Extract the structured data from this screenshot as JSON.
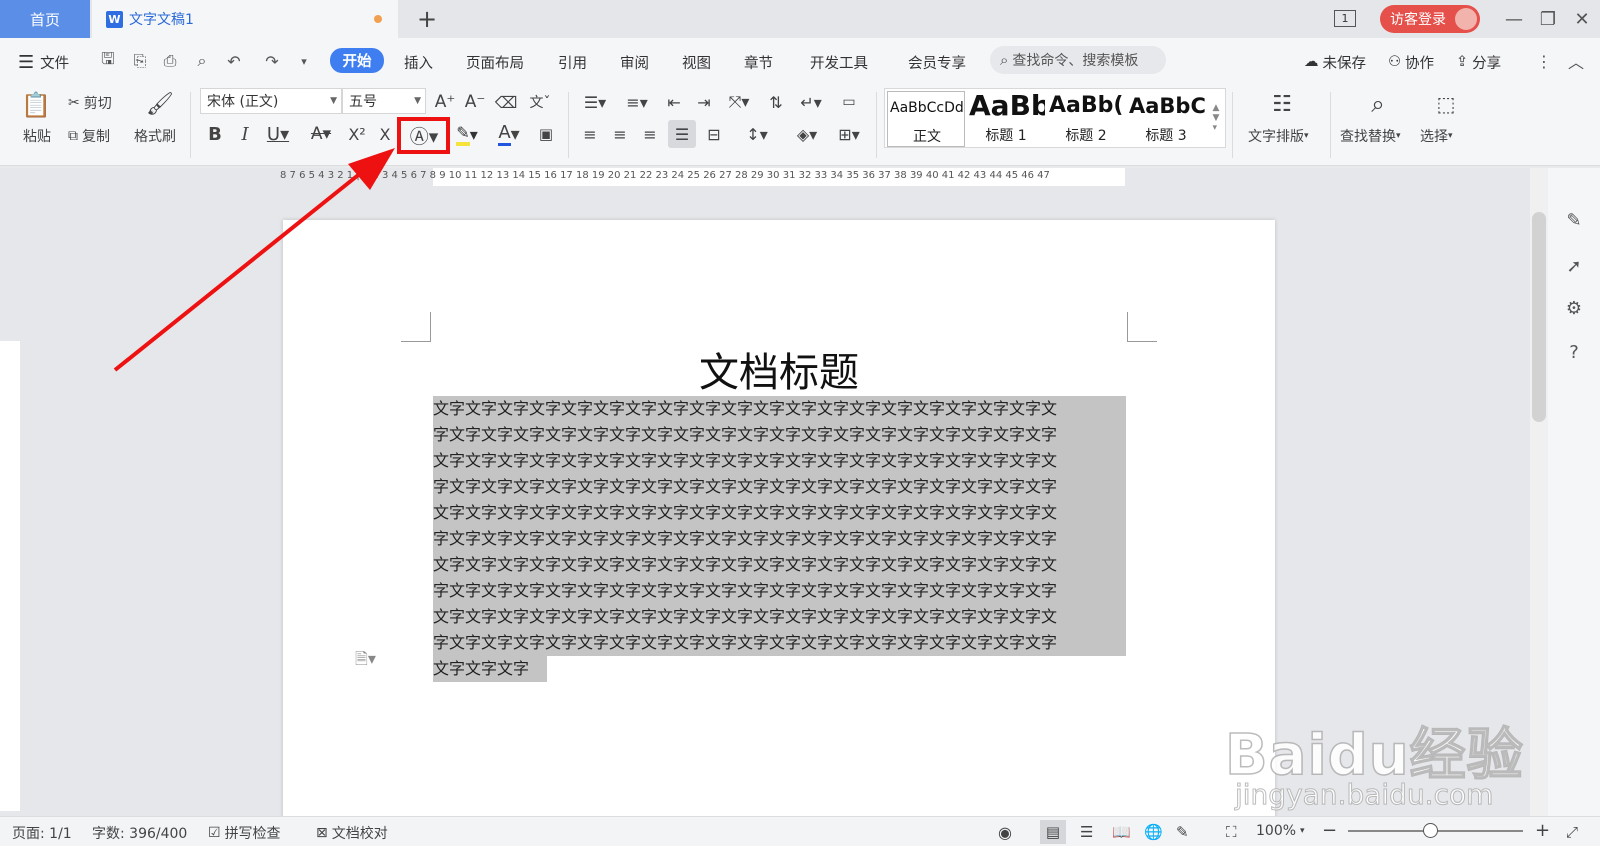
{
  "tabs": {
    "home": "首页",
    "doc": "文字文稿1",
    "add": "+"
  },
  "titlebar": {
    "window_count": "1",
    "login": "访客登录"
  },
  "menu": {
    "file": "文件",
    "tabs": [
      "开始",
      "插入",
      "页面布局",
      "引用",
      "审阅",
      "视图",
      "章节",
      "开发工具",
      "会员专享"
    ],
    "search": "查找命令、搜索模板",
    "unsaved": "未保存",
    "collab": "协作",
    "share": "分享"
  },
  "ribbon": {
    "paste": "粘贴",
    "cut": "剪切",
    "copy": "复制",
    "format_painter": "格式刷",
    "font_name": "宋体 (正文)",
    "font_size": "五号",
    "styles": [
      {
        "preview": "AaBbCcDd",
        "name": "正文"
      },
      {
        "preview": "AaBb",
        "name": "标题 1"
      },
      {
        "preview": "AaBb(",
        "name": "标题 2"
      },
      {
        "preview": "AaBbC",
        "name": "标题 3"
      }
    ],
    "text_layout": "文字排版",
    "find_replace": "查找替换",
    "select": "选择"
  },
  "ruler": {
    "numbers": "8 7 6 5 4 3 2 1 | 1 2 3 4 5 6 7 8 9 10 11 12 13 14 15 16 17 18 19 20 21 22 23 24 25 26 27 28 29 30 31 32 33 34 35 36 37 38 39 40 41 42 43 44 45 46 47"
  },
  "document": {
    "title": "文档标题",
    "lines": [
      "文字文字文字文字文字文字文字文字文字文字文字文字文字文字文字文字文字文字文字文",
      "字文字文字文字文字文字文字文字文字文字文字文字文字文字文字文字文字文字文字文字",
      "文字文字文字文字文字文字文字文字文字文字文字文字文字文字文字文字文字文字文字文",
      "字文字文字文字文字文字文字文字文字文字文字文字文字文字文字文字文字文字文字文字",
      "文字文字文字文字文字文字文字文字文字文字文字文字文字文字文字文字文字文字文字文",
      "字文字文字文字文字文字文字文字文字文字文字文字文字文字文字文字文字文字文字文字",
      "文字文字文字文字文字文字文字文字文字文字文字文字文字文字文字文字文字文字文字文",
      "字文字文字文字文字文字文字文字文字文字文字文字文字文字文字文字文字文字文字文字",
      "文字文字文字文字文字文字文字文字文字文字文字文字文字文字文字文字文字文字文字文",
      "字文字文字文字文字文字文字文字文字文字文字文字文字文字文字文字文字文字文字文字",
      "文字文字文字"
    ]
  },
  "status": {
    "page": "页面: 1/1",
    "words": "字数: 396/400",
    "spell": "拼写检查",
    "proof": "文档校对",
    "zoom": "100%"
  },
  "watermark": {
    "brand": "Baidu经验",
    "url": "jingyan.baidu.com"
  },
  "colors": {
    "accent": "#3f7ef0",
    "home_tab": "#5b8ee7",
    "login": "#e5504a",
    "highlight": "#e11111",
    "selection": "#c4c4c4"
  }
}
